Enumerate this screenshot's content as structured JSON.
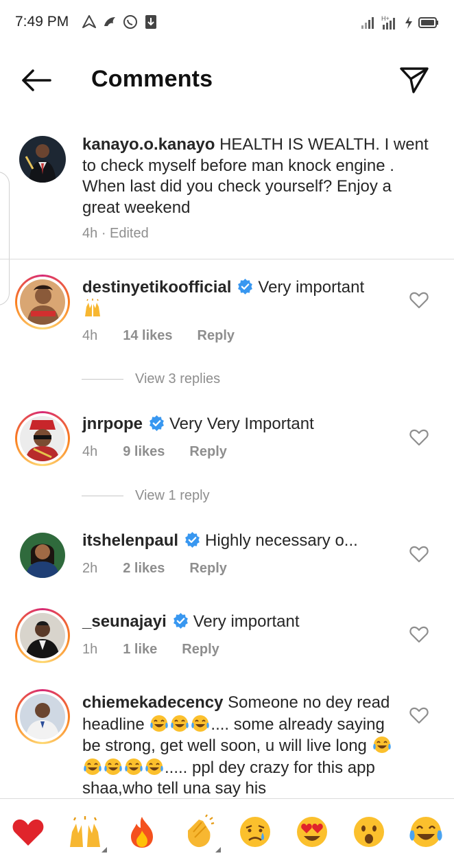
{
  "status": {
    "time": "7:49 PM",
    "left_icons": [
      "navigation-icon",
      "bird-icon",
      "whatsapp-icon",
      "download-icon"
    ],
    "right_icons": [
      "signal-icon",
      "hplus-signal-icon",
      "charging-bolt-icon",
      "battery-icon"
    ]
  },
  "header": {
    "title": "Comments",
    "back_icon": "back-arrow-icon",
    "share_icon": "send-icon"
  },
  "caption": {
    "username": "kanayo.o.kanayo",
    "text": "HEALTH IS WEALTH. I went to check myself before man  knock engine . When last did you check yourself? Enjoy a great weekend",
    "time": "4h",
    "edited": "· Edited"
  },
  "comments": [
    {
      "username": "destinyetikoofficial",
      "verified": true,
      "text": "Very important",
      "emoji": "raising-hands-emoji",
      "time": "4h",
      "likes": "14 likes",
      "reply": "Reply",
      "view_replies": "View 3 replies"
    },
    {
      "username": "jnrpope",
      "verified": true,
      "text": "Very Very Important",
      "time": "4h",
      "likes": "9 likes",
      "reply": "Reply",
      "view_replies": "View 1 reply"
    },
    {
      "username": "itshelenpaul",
      "verified": true,
      "text": "Highly necessary o...",
      "time": "2h",
      "likes": "2 likes",
      "reply": "Reply"
    },
    {
      "username": "_seunajayi",
      "verified": true,
      "text": "Very important",
      "time": "1h",
      "likes": "1 like",
      "reply": "Reply"
    },
    {
      "username": "chiemekadecency",
      "verified": false,
      "text_a": "Someone no dey read headline",
      "text_b": ".... some already saying be strong, get well soon, u will live long",
      "text_c": "..... ppl dey crazy for this app shaa,who tell una say his",
      "emoji": "tears-of-joy-emoji"
    }
  ],
  "reactions": [
    "red-heart",
    "raising-hands",
    "fire",
    "clapping-hands",
    "crying-face",
    "heart-eyes",
    "astonished-face",
    "tears-of-joy"
  ],
  "colors": {
    "text": "#262626",
    "meta": "#8e8e8e",
    "verified": "#3897f0",
    "divider": "#dbdbdb"
  }
}
